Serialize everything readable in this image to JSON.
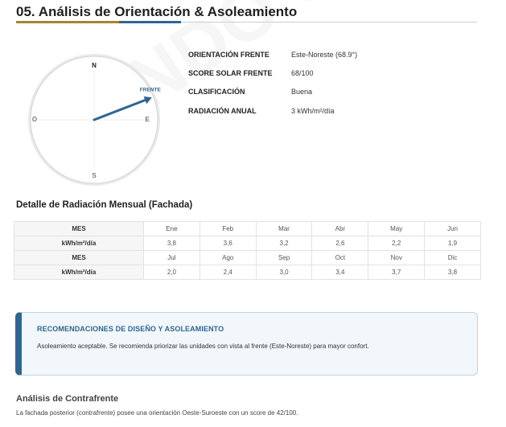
{
  "page": {
    "title": "05. Análisis de Orientación & Asoleamiento"
  },
  "compass": {
    "north": "N",
    "south": "S",
    "east": "E",
    "west": "O",
    "front_label": "FRENTE",
    "front_degrees": 68.9,
    "accent_color": "#2f6690"
  },
  "info": {
    "rows": [
      {
        "label": "ORIENTACIÓN FRENTE",
        "value": "Este-Noreste (68.9°)"
      },
      {
        "label": "SCORE SOLAR FRENTE",
        "value": "68/100"
      },
      {
        "label": "CLASIFICACIÓN",
        "value": "Buena"
      },
      {
        "label": "RADIACIÓN ANUAL",
        "value": "3 kWh/m²/día"
      }
    ]
  },
  "monthly": {
    "title": "Detalle de Radiación Mensual (Fachada)",
    "blocks": [
      {
        "month_header": "MES",
        "value_header": "kWh/m²/día",
        "months": [
          "Ene",
          "Feb",
          "Mar",
          "Abr",
          "May",
          "Jun"
        ],
        "values": [
          "3,8",
          "3,6",
          "3,2",
          "2,6",
          "2,2",
          "1,9"
        ]
      },
      {
        "month_header": "MES",
        "value_header": "kWh/m²/día",
        "months": [
          "Jul",
          "Ago",
          "Sep",
          "Oct",
          "Nov",
          "Dic"
        ],
        "values": [
          "2,0",
          "2,4",
          "3,0",
          "3,4",
          "3,7",
          "3,8"
        ]
      }
    ]
  },
  "recommendations": {
    "title": "RECOMENDACIONES DE DISEÑO Y ASOLEAMIENTO",
    "text": "Asoleamiento aceptable. Se recomienda priorizar las unidades con vista al frente (Este-Noreste) para mayor confort."
  },
  "contrafrente": {
    "title": "Análisis de Contrafrente",
    "text": "La fachada posterior (contrafrente) posee una orientación Oeste-Suroeste con un score de 42/100."
  }
}
